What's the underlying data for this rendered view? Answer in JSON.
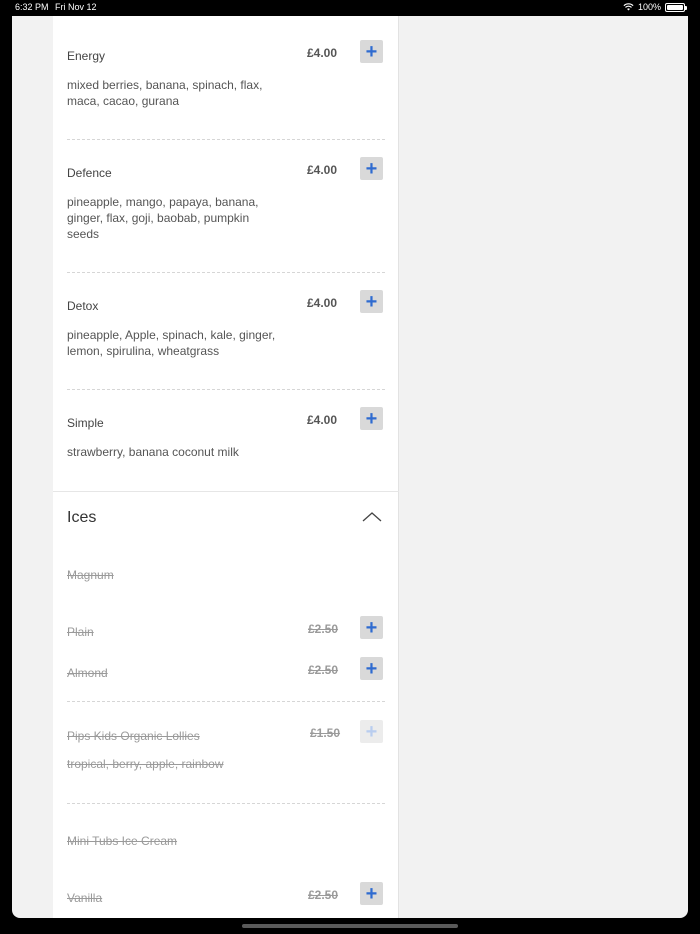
{
  "status": {
    "time": "6:32 PM",
    "date": "Fri Nov 12",
    "battery": "100%"
  },
  "menu": {
    "smoothies": [
      {
        "name": "Energy",
        "price": "£4.00",
        "desc": "mixed berries, banana, spinach, flax, maca, cacao, gurana"
      },
      {
        "name": "Defence",
        "price": "£4.00",
        "desc": "pineapple, mango, papaya, banana, ginger, flax, goji, baobab, pumpkin seeds"
      },
      {
        "name": "Detox",
        "price": "£4.00",
        "desc": "pineapple, Apple, spinach, kale, ginger, lemon, spirulina, wheatgrass"
      },
      {
        "name": "Simple",
        "price": "£4.00",
        "desc": "strawberry, banana coconut milk"
      }
    ],
    "ices": {
      "title": "Ices",
      "magnum_group": "Magnum",
      "plain": {
        "name": "Plain",
        "price": "£2.50"
      },
      "almond": {
        "name": "Almond",
        "price": "£2.50"
      },
      "lollies": {
        "name": "Pips Kids Organic Lollies",
        "price": "£1.50",
        "desc": "tropical, berry, apple, rainbow"
      },
      "tubs_group": "Mini Tubs Ice Cream",
      "vanilla": {
        "name": "Vanilla",
        "price": "£2.50"
      }
    },
    "add_symbol": "+"
  }
}
